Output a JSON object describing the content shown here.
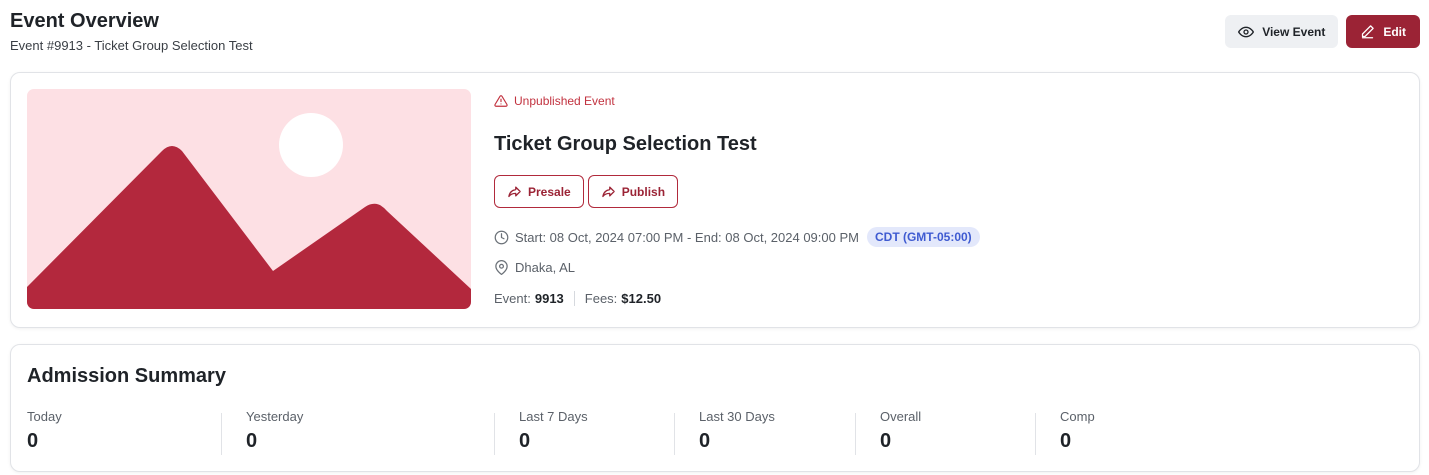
{
  "header": {
    "title": "Event Overview",
    "subtitle": "Event #9913 - Ticket Group Selection Test",
    "view_label": "View Event",
    "edit_label": "Edit"
  },
  "event": {
    "status": "Unpublished Event",
    "title": "Ticket Group Selection Test",
    "presale_label": "Presale",
    "publish_label": "Publish",
    "dates": "Start: 08 Oct, 2024 07:00 PM - End: 08 Oct, 2024 09:00 PM",
    "timezone": "CDT (GMT-05:00)",
    "location": "Dhaka, AL",
    "event_label": "Event:",
    "event_id": "9913",
    "fees_label": "Fees:",
    "fees": "$12.50"
  },
  "admission": {
    "title": "Admission Summary",
    "stats": [
      {
        "label": "Today",
        "value": "0"
      },
      {
        "label": "Yesterday",
        "value": "0"
      },
      {
        "label": "Last 7 Days",
        "value": "0"
      },
      {
        "label": "Last 30 Days",
        "value": "0"
      },
      {
        "label": "Overall",
        "value": "0"
      },
      {
        "label": "Comp",
        "value": "0"
      }
    ]
  },
  "colors": {
    "brand": "#9b2335",
    "warning": "#c2323f",
    "badge_bg": "#e3e8fb",
    "badge_text": "#3f5bd1",
    "image_bg": "#fde0e4"
  },
  "icons": [
    "eye-icon",
    "pencil-icon",
    "alert-triangle-icon",
    "share-icon",
    "clock-icon",
    "map-pin-icon",
    "image-placeholder-icon"
  ]
}
